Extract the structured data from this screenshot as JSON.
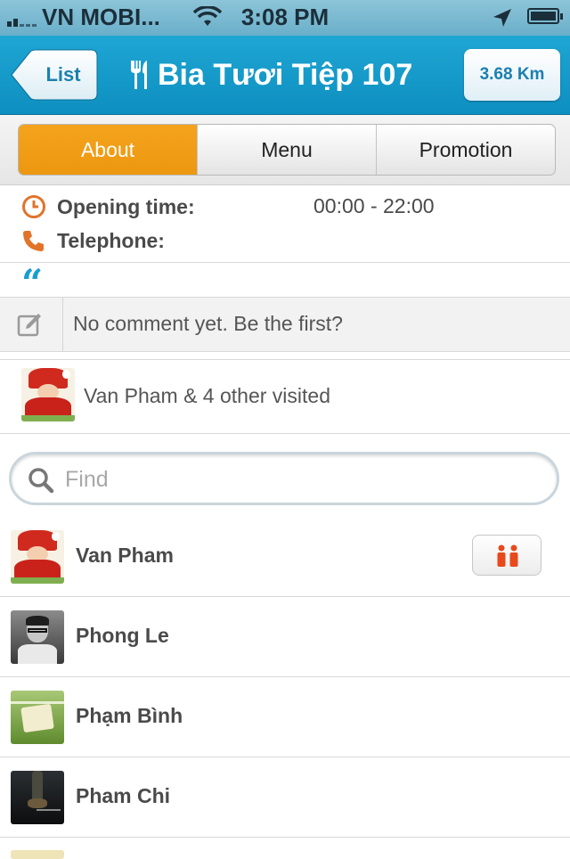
{
  "status_bar": {
    "carrier": "VN MOBI...",
    "time": "3:08 PM"
  },
  "nav": {
    "back_label": "List",
    "title": "Bia Tươi Tiệp 107",
    "distance": "3.68 Km"
  },
  "tabs": [
    {
      "label": "About",
      "active": true
    },
    {
      "label": "Menu",
      "active": false
    },
    {
      "label": "Promotion",
      "active": false
    }
  ],
  "info": {
    "opening_label": "Opening time:",
    "opening_value": "00:00 - 22:00",
    "telephone_label": "Telephone:"
  },
  "quote_mark": "“",
  "comment": {
    "placeholder": "No comment yet. Be the first?"
  },
  "visited": {
    "text": "Van Pham & 4 other visited"
  },
  "search": {
    "placeholder": "Find"
  },
  "users": [
    {
      "name": "Van Pham",
      "has_action": true
    },
    {
      "name": "Phong Le",
      "has_action": false
    },
    {
      "name": "Phạm Bình",
      "has_action": false
    },
    {
      "name": "Pham Chi",
      "has_action": false
    }
  ],
  "colors": {
    "nav_blue": "#1199c8",
    "active_tab": "#f0a018",
    "icon_orange": "#e2732a",
    "quote_blue": "#1a9dd0",
    "friend_icon": "#e8491c"
  },
  "icons": [
    "wifi-icon",
    "location-arrow-icon",
    "battery-icon",
    "utensils-icon",
    "clock-icon",
    "phone-icon",
    "quote-icon",
    "edit-icon",
    "search-icon",
    "friends-icon"
  ]
}
